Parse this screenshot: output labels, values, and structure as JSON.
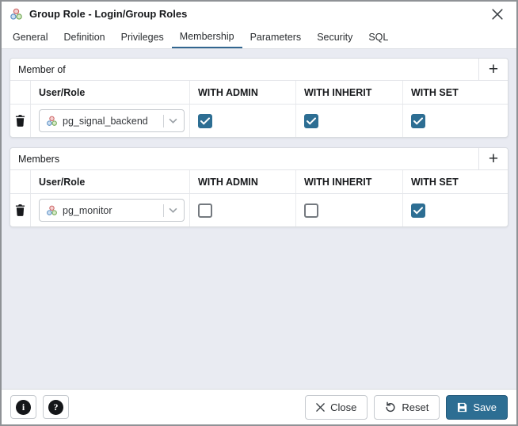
{
  "window": {
    "title": "Group Role - Login/Group Roles"
  },
  "tabs": {
    "items": [
      "General",
      "Definition",
      "Privileges",
      "Membership",
      "Parameters",
      "Security",
      "SQL"
    ],
    "active": "Membership"
  },
  "icons": {
    "add": "+",
    "info": "i",
    "help": "?"
  },
  "sections": [
    {
      "title": "Member of",
      "columns": {
        "user_role": "User/Role",
        "with_admin": "WITH ADMIN",
        "with_inherit": "WITH INHERIT",
        "with_set": "WITH SET"
      },
      "rows": [
        {
          "role": "pg_signal_backend",
          "with_admin": true,
          "with_inherit": true,
          "with_set": true
        }
      ]
    },
    {
      "title": "Members",
      "columns": {
        "user_role": "User/Role",
        "with_admin": "WITH ADMIN",
        "with_inherit": "WITH INHERIT",
        "with_set": "WITH SET"
      },
      "rows": [
        {
          "role": "pg_monitor",
          "with_admin": false,
          "with_inherit": false,
          "with_set": true
        }
      ]
    }
  ],
  "footer": {
    "close": "Close",
    "reset": "Reset",
    "save": "Save"
  },
  "colors": {
    "primary": "#2d6e93",
    "tab_underline": "#326690"
  }
}
